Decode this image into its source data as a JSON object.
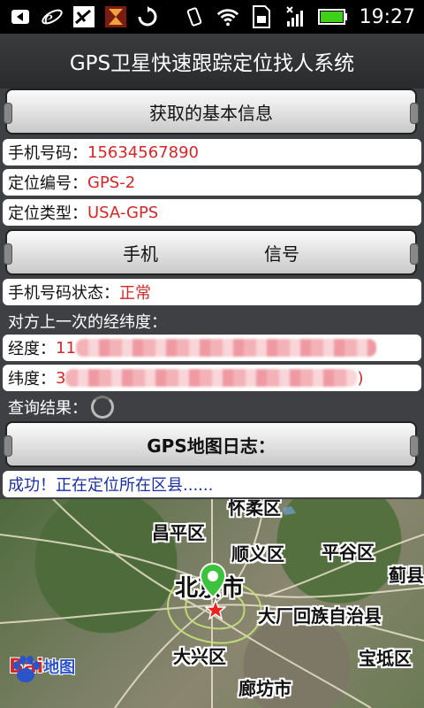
{
  "statusbar": {
    "time": "19:27",
    "icons": [
      "back-arrow-icon",
      "ie-icon",
      "app-icon",
      "hourglass-icon",
      "sync-icon",
      "vibrate-icon",
      "wifi-icon",
      "sim-icon",
      "signal-icon",
      "battery-icon"
    ]
  },
  "app": {
    "title": "GPS卫星快速跟踪定位找人系统"
  },
  "buttons": {
    "basic_info": "获取的基本信息",
    "phone": "手机",
    "signal": "信号",
    "gps_log": "GPS地图日志："
  },
  "fields": {
    "phone_label": "手机号码：",
    "phone_value": "15634567890",
    "locate_id_label": "定位编号：",
    "locate_id_value": "GPS-2",
    "locate_type_label": "定位类型：",
    "locate_type_value": "USA-GPS",
    "phone_status_label": "手机号码状态：",
    "phone_status_value": "正常",
    "last_coords_label": "对方上一次的经纬度：",
    "longitude_label": "经度：",
    "longitude_value": "11",
    "latitude_label": "纬度：",
    "latitude_value": "3",
    "latitude_tail": ")",
    "query_result_label": "查询结果："
  },
  "status_message": "成功！正在定位所在区县......",
  "map": {
    "labels": {
      "huairou": "怀柔区",
      "changping": "昌平区",
      "shunyi": "顺义区",
      "pinggu": "平谷区",
      "ji": "蓟县",
      "beijing": "北京市",
      "dachang": "大厂回族自治县",
      "daxing": "大兴区",
      "baodi": "宝坻区",
      "langfang": "廊坊市"
    },
    "logo": {
      "bai": "Bai",
      "du_map": "地图"
    },
    "accent": "#d22828"
  }
}
